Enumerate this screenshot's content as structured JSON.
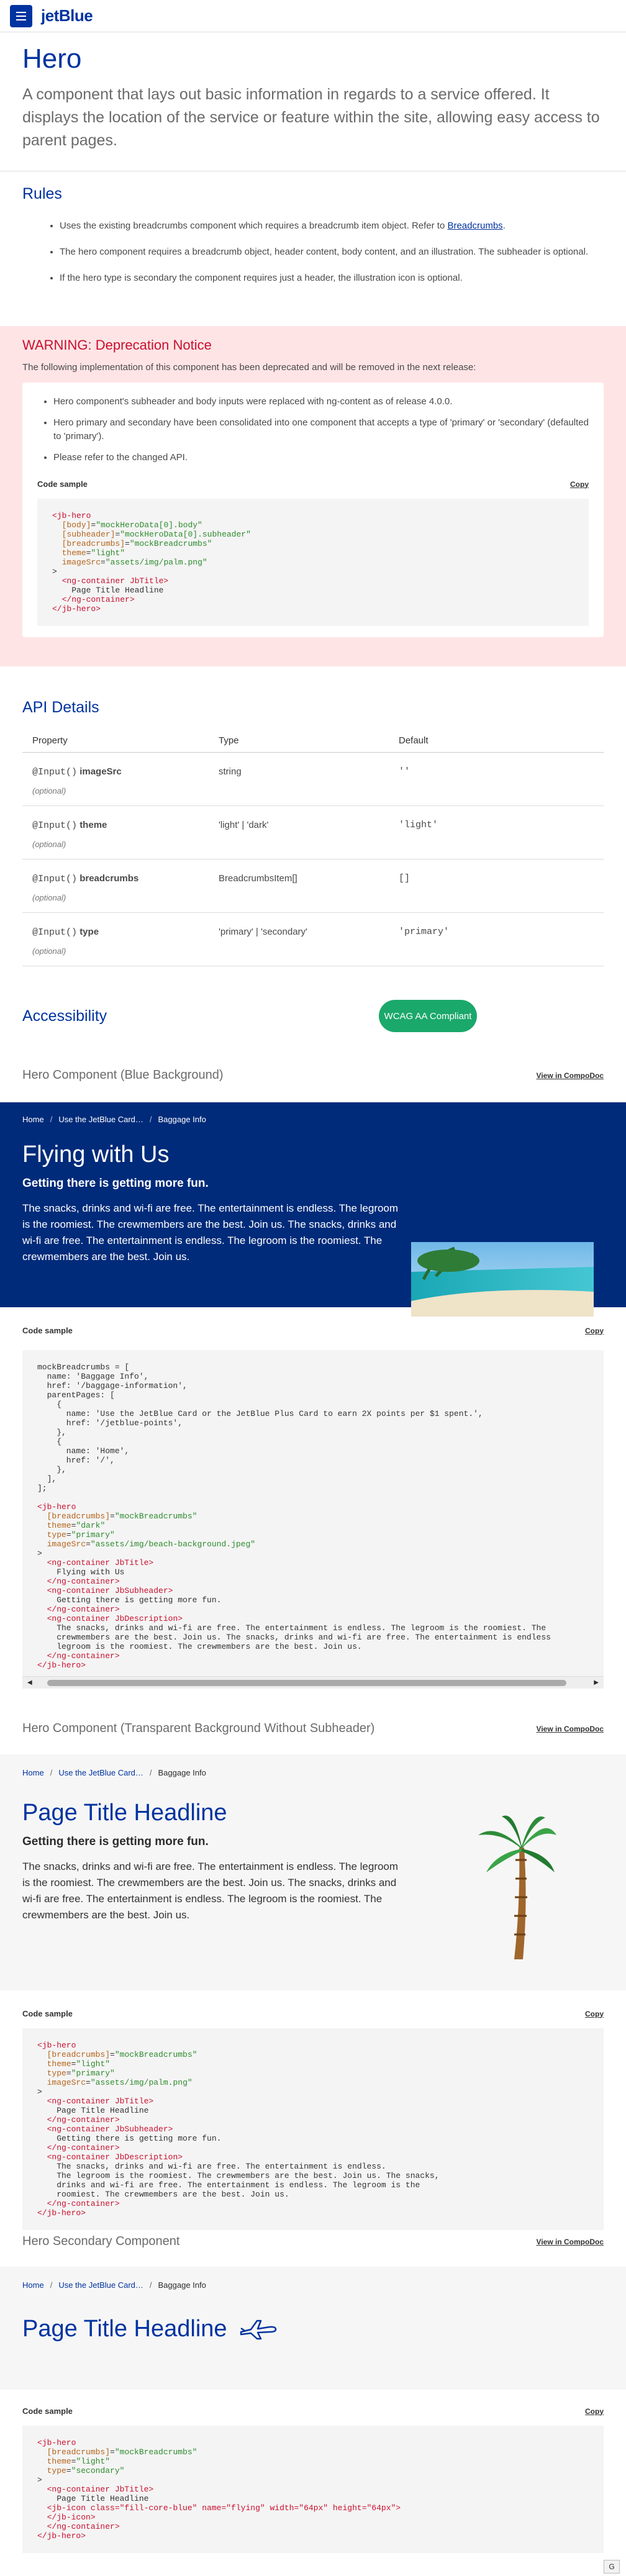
{
  "header": {
    "logo": "jetBlue"
  },
  "page": {
    "title": "Hero",
    "description": "A component that lays out basic information in regards to a service offered. It displays the location of the service or feature within the site, allowing easy access to parent pages."
  },
  "rules": {
    "heading": "Rules",
    "items": [
      {
        "text": "Uses the existing breadcrumbs component which requires a breadcrumb item object. Refer to",
        "link": "Breadcrumbs",
        "after": "."
      },
      {
        "text": "The hero component requires a breadcrumb object, header content, body content, and an illustration. The subheader is optional."
      },
      {
        "text": "If the hero type is secondary the component requires just a header, the illustration icon is optional."
      }
    ]
  },
  "warning": {
    "heading": "WARNING: Deprecation Notice",
    "intro": "The following implementation of this component has been deprecated and will be removed in the next release:",
    "items": [
      "Hero component's subheader and body inputs were replaced with ng-content as of release 4.0.0.",
      "Hero primary and secondary have been consolidated into one component that accepts a type of 'primary' or 'secondary' (defaulted to 'primary').",
      "Please refer to the changed API."
    ],
    "code_label": "Code sample",
    "copy_label": "Copy"
  },
  "api": {
    "heading": "API Details",
    "columns": [
      "Property",
      "Type",
      "Default"
    ],
    "rows": [
      {
        "decorator": "@Input()",
        "name": "imageSrc",
        "optional": "(optional)",
        "type": "string",
        "default": "''"
      },
      {
        "decorator": "@Input()",
        "name": "theme",
        "optional": "(optional)",
        "type": "'light' | 'dark'",
        "default": "'light'"
      },
      {
        "decorator": "@Input()",
        "name": "breadcrumbs",
        "optional": "(optional)",
        "type": "BreadcrumbsItem[]",
        "default": "[]"
      },
      {
        "decorator": "@Input()",
        "name": "type",
        "optional": "(optional)",
        "type": "'primary' | 'secondary'",
        "default": "'primary'"
      }
    ]
  },
  "accessibility": {
    "heading": "Accessibility",
    "badge": "WCAG AA Compliant"
  },
  "demo1": {
    "heading": "Hero Component (Blue Background)",
    "view_link": "View in CompoDoc",
    "breadcrumbs": [
      "Home",
      "Use the JetBlue Card…",
      "Baggage Info"
    ],
    "title": "Flying with Us",
    "subheader": "Getting there is getting more fun.",
    "body": "The snacks, drinks and wi-fi are free. The entertainment is endless. The legroom is the roomiest. The crewmembers are the best. Join us. The snacks, drinks and wi-fi are free. The entertainment is endless. The legroom is the roomiest. The crewmembers are the best. Join us.",
    "code_label": "Code sample",
    "copy_label": "Copy"
  },
  "demo2": {
    "heading": "Hero Component (Transparent Background Without Subheader)",
    "view_link": "View in CompoDoc",
    "breadcrumbs": [
      "Home",
      "Use the JetBlue Card…",
      "Baggage Info"
    ],
    "title": "Page Title Headline",
    "subheader": "Getting there is getting more fun.",
    "body": "The snacks, drinks and wi-fi are free. The entertainment is endless. The legroom is the roomiest. The crewmembers are the best. Join us. The snacks, drinks and wi-fi are free. The entertainment is endless. The legroom is the roomiest. The crewmembers are the best. Join us.",
    "code_label": "Code sample",
    "copy_label": "Copy"
  },
  "demo3": {
    "heading": "Hero Secondary Component",
    "view_link": "View in CompoDoc",
    "breadcrumbs": [
      "Home",
      "Use the JetBlue Card…",
      "Baggage Info"
    ],
    "title": "Page Title Headline",
    "code_label": "Code sample",
    "copy_label": "Copy"
  },
  "corner_button": "G",
  "colors": {
    "brand": "#0033a0",
    "dark_blue": "#002b7a",
    "warning_bg": "#ffe4e6",
    "warning_text": "#c8102e",
    "success": "#1ba86b"
  }
}
